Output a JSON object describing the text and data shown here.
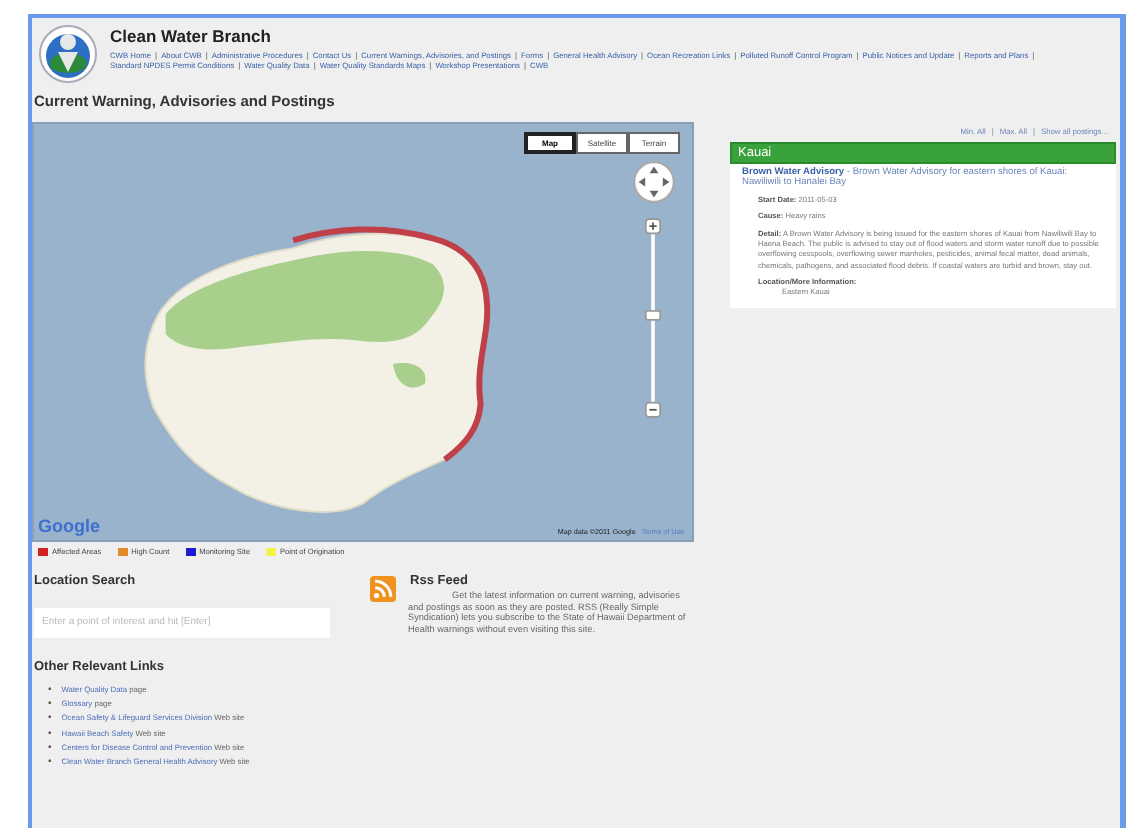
{
  "header": {
    "title": "Clean Water Branch",
    "separator": "|",
    "nav": [
      "CWB Home",
      "About CWB",
      "Administrative Procedures",
      "Contact Us",
      "Current Warnings, Advisories, and Postings",
      "Forms",
      "General Health Advisory",
      "Ocean Recreation Links",
      "Polluted Runoff Control Program",
      "Public Notices and Update",
      "Reports and Plans",
      "Standard NPDES Permit Conditions",
      "Water Quality Data",
      "Water Quality Standards Maps",
      "Workshop Presentations",
      "CWB"
    ]
  },
  "page_title": "Current Warning, Advisories and Postings",
  "map": {
    "map_types": [
      {
        "label": "Map",
        "selected": true
      },
      {
        "label": "Satellite",
        "selected": false
      },
      {
        "label": "Terrain",
        "selected": false
      }
    ],
    "logo": "Google",
    "attribution": "Map data ©2011 Google",
    "terms": "Terms of Use"
  },
  "legend": [
    {
      "label": "Affected Areas",
      "color": "#d42020"
    },
    {
      "label": "High Count",
      "color": "#e08a2a"
    },
    {
      "label": "Monitoring Site",
      "color": "#1a1ad0"
    },
    {
      "label": "Point of Origination",
      "color": "#f2f24a"
    }
  ],
  "postings": {
    "controls": [
      "Min. All",
      "Max. All",
      "Show all postings..."
    ],
    "separator": "|",
    "region": "Kauai",
    "advisory": {
      "title": "Brown Water Advisory",
      "summary": " - Brown Water Advisory for eastern shores of Kauai: Nawiliwili to Hanalei Bay",
      "fields": [
        {
          "label": "Start Date:",
          "value": "2011-05-03"
        },
        {
          "label": "Cause:",
          "value": "Heavy rains"
        },
        {
          "label": "Detail:",
          "value": "A Brown Water Advisory is being issued for the eastern shores of Kauai from Nawiliwili Bay to Haena Beach. The public is advised to stay out of flood waters and storm water runoff due to possible overflowing cesspools, overflowing sewer manholes, pesticides, animal fecal matter, dead animals, chemicals, pathogens, and associated flood debris. If coastal waters are turbid and brown, stay out."
        }
      ],
      "location_label": "Location/More Information:",
      "location": "Eastern Kauai"
    }
  },
  "location_search": {
    "title": "Location Search",
    "placeholder": "Enter a point of interest and hit [Enter]"
  },
  "other_links": {
    "title": "Other Relevant Links",
    "bullet": "•",
    "items": [
      {
        "link": "Water Quality Data",
        "suffix": " page"
      },
      {
        "link": "Glossary",
        "suffix": " page"
      },
      {
        "link": "Ocean Safety & Lifeguard Services Division",
        "suffix": " Web site"
      },
      {
        "link": "Hawaii Beach Safety",
        "suffix": " Web site"
      },
      {
        "link": "Centers for Disease Control and Prevention",
        "suffix": " Web site"
      },
      {
        "link": "Clean Water Branch General Health Advisory",
        "suffix": " Web site"
      }
    ]
  },
  "rss": {
    "title": "Rss Feed",
    "text": "Get the latest information on current warning, advisories and postings as soon as they are posted. RSS (Really Simple Syndication) lets you subscribe to the State of Hawaii Department of Health warnings without even visiting this site."
  }
}
